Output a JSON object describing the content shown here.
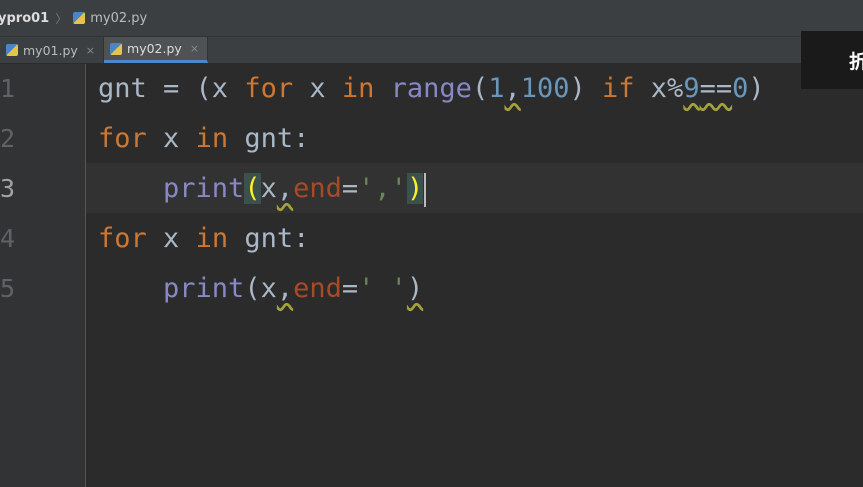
{
  "breadcrumb": {
    "project": "ypro01",
    "file": "my02.py"
  },
  "tabs": [
    {
      "label": "my01.py",
      "close": "×"
    },
    {
      "label": "my02.py",
      "close": "×"
    }
  ],
  "line_numbers": [
    "1",
    "2",
    "3",
    "4",
    "5"
  ],
  "code": {
    "l1": {
      "a": "gnt = (x ",
      "kw1": "for",
      "b": " x ",
      "kw2": "in",
      "c": " ",
      "fn": "range",
      "d": "(",
      "n1": "1",
      "e": ",",
      "n2": "100",
      "f": ") ",
      "kw3": "if",
      "g": " x%",
      "n3": "9",
      "h": "==",
      "n4": "0",
      "i": ")"
    },
    "l2": {
      "kw1": "for",
      "a": " x ",
      "kw2": "in",
      "b": " gnt:"
    },
    "l3": {
      "indent": "    ",
      "fn": "print",
      "p1": "(",
      "a": "x",
      "comma": ",",
      "param": "end",
      "eq": "=",
      "str": "','",
      "p2": ")"
    },
    "l4": {
      "kw1": "for",
      "a": " x ",
      "kw2": "in",
      "b": " gnt:"
    },
    "l5": {
      "indent": "    ",
      "fn": "print",
      "p1": "(",
      "a": "x",
      "comma": ",",
      "param": "end",
      "eq": "=",
      "str": "' '",
      "p2": ")"
    }
  },
  "popup": {
    "text": "折"
  },
  "colors": {
    "keyword": "#cc7832",
    "builtin": "#8888c6",
    "number": "#6897bb",
    "string": "#6a8759",
    "param": "#aa4926",
    "text": "#a9b7c6"
  }
}
